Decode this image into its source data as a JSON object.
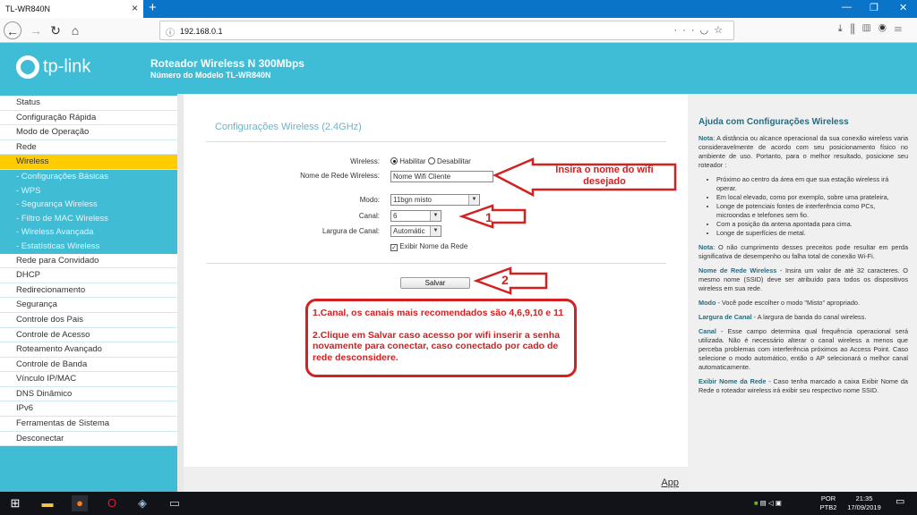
{
  "browser": {
    "tab_title": "TL-WR840N",
    "close_glyph": "×",
    "url": "192.168.0.1",
    "icons": [
      "back-icon",
      "forward-icon",
      "reload-icon",
      "home-icon",
      "info-icon",
      "more-icon",
      "pocket-icon",
      "star-icon",
      "download-icon",
      "library-icon",
      "sidebar-icon",
      "account-icon",
      "menu-icon"
    ]
  },
  "header": {
    "brand": "tp-link",
    "title": "Roteador Wireless N 300Mbps",
    "subtitle": "Número do Modelo TL-WR840N"
  },
  "sidebar": {
    "items": [
      {
        "label": "Status",
        "type": "main"
      },
      {
        "label": "Configuração Rápida",
        "type": "main"
      },
      {
        "label": "Modo de Operação",
        "type": "main"
      },
      {
        "label": "Rede",
        "type": "main"
      },
      {
        "label": "Wireless",
        "type": "active"
      },
      {
        "label": "- Configurações Básicas",
        "type": "sub"
      },
      {
        "label": "- WPS",
        "type": "sub"
      },
      {
        "label": "- Segurança Wireless",
        "type": "sub"
      },
      {
        "label": "- Filtro de MAC Wireless",
        "type": "sub"
      },
      {
        "label": "- Wireless Avançada",
        "type": "sub"
      },
      {
        "label": "- Estatísticas Wireless",
        "type": "sub"
      },
      {
        "label": "Rede para Convidado",
        "type": "main"
      },
      {
        "label": "DHCP",
        "type": "main"
      },
      {
        "label": "Redirecionamento",
        "type": "main"
      },
      {
        "label": "Segurança",
        "type": "main"
      },
      {
        "label": "Controle dos Pais",
        "type": "main"
      },
      {
        "label": "Controle de Acesso",
        "type": "main"
      },
      {
        "label": "Roteamento Avançado",
        "type": "main"
      },
      {
        "label": "Controle de Banda",
        "type": "main"
      },
      {
        "label": "Vínculo IP/MAC",
        "type": "main"
      },
      {
        "label": "DNS Dinâmico",
        "type": "main"
      },
      {
        "label": "IPv6",
        "type": "main"
      },
      {
        "label": "Ferramentas de Sistema",
        "type": "main"
      },
      {
        "label": "Desconectar",
        "type": "main"
      }
    ]
  },
  "form": {
    "section_title": "Configurações Wireless (2.4GHz)",
    "wireless_label": "Wireless:",
    "enable_label": "Habilitar",
    "disable_label": "Desabilitar",
    "ssid_label": "Nome de Rede Wireless:",
    "ssid_value": "Nome Wifi Cliente",
    "mode_label": "Modo:",
    "mode_value": "11bgn misto",
    "channel_label": "Canal:",
    "channel_value": "6",
    "width_label": "Largura de Canal:",
    "width_value": "Automátic",
    "broadcast_label": "Exibir Nome da Rede",
    "save_label": "Salvar"
  },
  "annotations": {
    "arrow1_text": "Insira o nome do wifi desejado",
    "arrow2_text": "1",
    "arrow3_text": "2",
    "callout_line1": "1.Canal, os canais mais recomendados são 4,6,9,10 e 11",
    "callout_line2": "2.Clique em Salvar caso acesso por wifi inserir a senha novamente para conectar, caso conectado por cado de rede desconsidere.",
    "color": "#d32020"
  },
  "help": {
    "title": "Ajuda com Configurações Wireless",
    "nota1_label": "Nota",
    "nota1": ": A distância ou alcance operacional da sua conexão wireless varia consideravelmente de acordo com seu posicionamento físico no ambiente de uso. Portanto, para o melhor resultado, posicione seu roteador :",
    "bullets": [
      "Próximo ao centro da área em que sua estação wireless irá operar.",
      "Em local elevado, como por exemplo, sobre uma prateleira,",
      "Longe de potenciais fontes de interferência como PCs, microondas e telefones sem fio.",
      "Com a posição da antena apontada para cima.",
      "Longe de superfícies de metal."
    ],
    "nota2_label": "Nota",
    "nota2": ": O não cumprimento desses preceitos pode resultar em perda significativa de desempenho ou falha total de conexão Wi-Fi.",
    "ssid_term": "Nome de Rede Wireless",
    "ssid_text": " - Insira um valor de até 32 caracteres. O mesmo nome (SSID) deve ser atribuído para todos os dispositivos wireless em sua rede.",
    "mode_term": "Modo",
    "mode_text": " - Você pode escolher o modo \"Misto\" apropriado.",
    "width_term": "Largura de Canal",
    "width_text": " - A largura de banda do canal wireless.",
    "channel_term": "Canal",
    "channel_text": " - Esse campo determina qual frequência operacional será utilizada. Não é necessário alterar o canal wireless a menos que perceba problemas com interferência próximos ao Access Point. Caso selecione o modo automático, então o AP selecionará o melhor canal automaticamente.",
    "broadcast_term": "Exibir Nome da Rede",
    "broadcast_text": " - Caso tenha marcado a caixa Exibir Nome da Rede o roteador wireless irá exibir seu respectivo nome SSID."
  },
  "footer": {
    "app_link": "App"
  },
  "taskbar": {
    "lang": "POR",
    "layout": "PTB2",
    "time": "21:35",
    "date": "17/09/2019"
  }
}
